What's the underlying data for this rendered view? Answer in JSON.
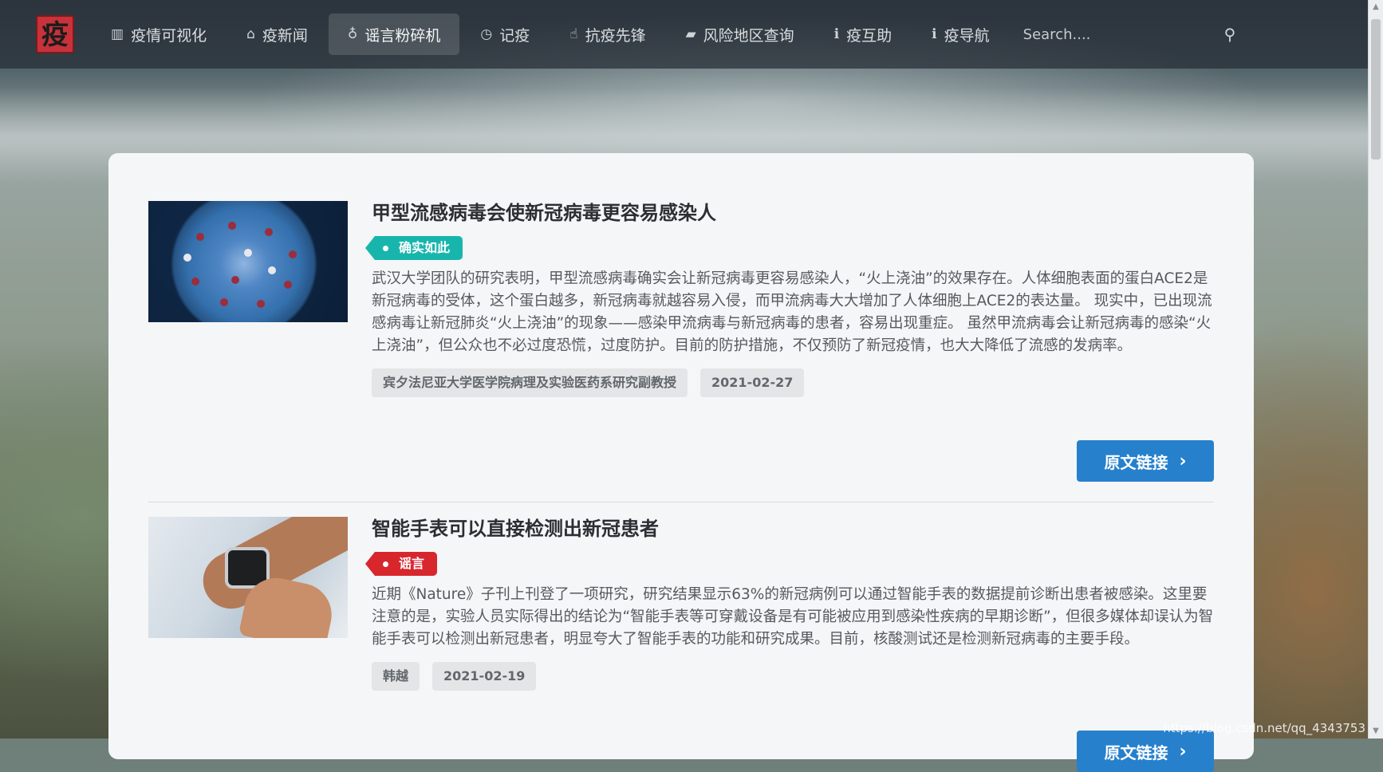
{
  "nav": {
    "logo_char": "疫",
    "items": [
      {
        "icon": "bar-chart-icon",
        "glyph": "▥",
        "label": "疫情可视化"
      },
      {
        "icon": "home-icon",
        "glyph": "⌂",
        "label": "疫新闻"
      },
      {
        "icon": "lightbulb-icon",
        "glyph": "♁",
        "label": "谣言粉碎机"
      },
      {
        "icon": "clock-icon",
        "glyph": "◷",
        "label": "记疫"
      },
      {
        "icon": "thumbs-up-icon",
        "glyph": "☝",
        "label": "抗疫先锋"
      },
      {
        "icon": "book-icon",
        "glyph": "▰",
        "label": "风险地区查询"
      },
      {
        "icon": "info-icon",
        "glyph": "ℹ",
        "label": "疫互助"
      },
      {
        "icon": "info-icon",
        "glyph": "ℹ",
        "label": "疫导航"
      }
    ],
    "active_index": 2,
    "search_placeholder": "Search....",
    "search_glyph": "⚲"
  },
  "articles": [
    {
      "title": "甲型流感病毒会使新冠病毒更容易感染人",
      "tag": "确实如此",
      "tag_type": "true",
      "description": "武汉大学团队的研究表明，甲型流感病毒确实会让新冠病毒更容易感染人，“火上浇油”的效果存在。人体细胞表面的蛋白ACE2是新冠病毒的受体，这个蛋白越多，新冠病毒就越容易入侵，而甲流病毒大大增加了人体细胞上ACE2的表达量。 现实中，已出现流感病毒让新冠肺炎“火上浇油”的现象——感染甲流病毒与新冠病毒的患者，容易出现重症。 虽然甲流病毒会让新冠病毒的感染“火上浇油”，但公众也不必过度恐慌，过度防护。目前的防护措施，不仅预防了新冠疫情，也大大降低了流感的发病率。",
      "author": "宾夕法尼亚大学医学院病理及实验医药系研究副教授",
      "date": "2021-02-27",
      "link_label": "原文链接"
    },
    {
      "title": "智能手表可以直接检测出新冠患者",
      "tag": "谣言",
      "tag_type": "false",
      "description": "近期《Nature》子刊上刊登了一项研究，研究结果显示63%的新冠病例可以通过智能手表的数据提前诊断出患者被感染。这里要注意的是，实验人员实际得出的结论为“智能手表等可穿戴设备是有可能被应用到感染性疾病的早期诊断”，但很多媒体却误认为智能手表可以检测出新冠患者，明显夸大了智能手表的功能和研究成果。目前，核酸测试还是检测新冠病毒的主要手段。",
      "author": "韩越",
      "date": "2021-02-19",
      "link_label": "原文链接"
    }
  ],
  "chevron": "›",
  "watermark": "https://blog.csdn.net/qq_4343753"
}
